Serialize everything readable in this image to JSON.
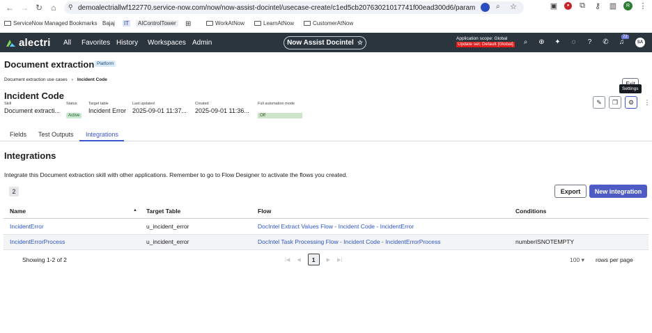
{
  "browser": {
    "url": "demoalectriallwf122770.service-now.com/now/now-assist-docintel/usecase-create/c1ed5cb20763021017741f00ead300d6/params/task...",
    "bookmarks": [
      "ServiceNow Managed Bookmarks",
      "Bajaj",
      "IT",
      "AIControlTower",
      "WorkAtNow",
      "LearnAtNow",
      "CustomerAtNow"
    ],
    "profile_initial": "R"
  },
  "header": {
    "brand": "alectri",
    "nav": [
      "All",
      "Favorites",
      "History",
      "Workspaces",
      "Admin"
    ],
    "center_pill": "Now Assist Docintel",
    "scope_line": "Application scope: Global",
    "update_set": "Update set: Default [Global]",
    "notif_count": "72",
    "avatar": "SA"
  },
  "page": {
    "title": "Document extraction",
    "badge": "Platform",
    "breadcrumb": [
      "Document extraction use cases",
      "Incident Code"
    ],
    "exit_label": "Exit",
    "settings_tooltip": "Settings"
  },
  "record": {
    "title": "Incident Code",
    "fields": [
      {
        "label": "Skill",
        "value": "Document extracti..."
      },
      {
        "label": "Status",
        "value": "Active"
      },
      {
        "label": "Target table",
        "value": "Incident Error"
      },
      {
        "label": "Last updated",
        "value": "2025-09-01 11:37..."
      },
      {
        "label": "Created",
        "value": "2025-09-01 11:36..."
      },
      {
        "label": "Full automation mode",
        "value": "Off"
      }
    ]
  },
  "tabs": [
    "Fields",
    "Test Outputs",
    "Integrations"
  ],
  "integrations": {
    "title": "Integrations",
    "description": "Integrate this Document extraction skill with other applications. Remember to go to Flow Designer to activate the flows you created.",
    "count": "2",
    "export_label": "Export",
    "new_label": "New integration",
    "columns": [
      "Name",
      "Target Table",
      "Flow",
      "Conditions"
    ],
    "rows": [
      {
        "name": "IncidentError",
        "table": "u_incident_error",
        "flow": "DocIntel Extract Values Flow - Incident Code - IncidentError",
        "conditions": ""
      },
      {
        "name": "IncidentErrorProcess",
        "table": "u_incident_error",
        "flow": "DocIntel Task Processing Flow - Incident Code - IncidentErrorProcess",
        "conditions": "numberISNOTEMPTY"
      }
    ],
    "pager": {
      "showing": "Showing 1-2 of 2",
      "current_page": "1",
      "rows_per_page": "100",
      "rows_label": "rows per page"
    }
  },
  "colors": {
    "header_bg": "#2a353e",
    "accent": "#3c54d6",
    "primary_button": "#4f5bc4",
    "update_set_red": "#e21b1b"
  }
}
